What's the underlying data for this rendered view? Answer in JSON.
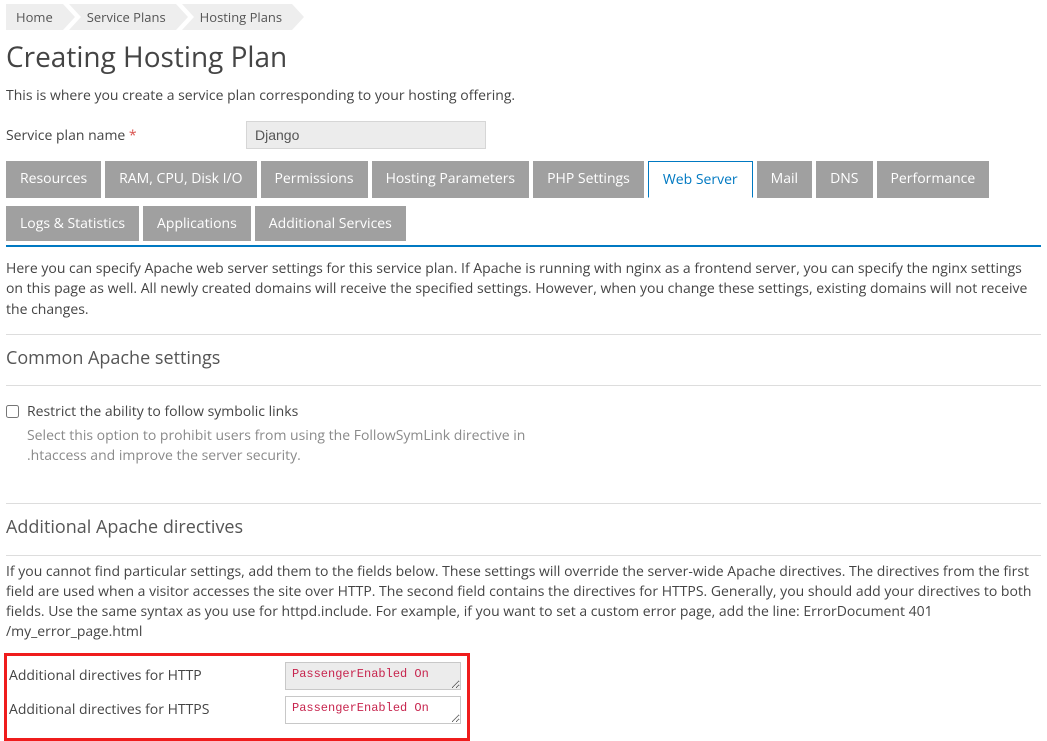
{
  "breadcrumb": [
    "Home",
    "Service Plans",
    "Hosting Plans"
  ],
  "title": "Creating Hosting Plan",
  "description": "This is where you create a service plan corresponding to your hosting offering.",
  "plan_name": {
    "label": "Service plan name",
    "required": "*",
    "value": "Django"
  },
  "tabs": [
    {
      "label": "Resources",
      "active": false
    },
    {
      "label": "RAM, CPU, Disk I/O",
      "active": false
    },
    {
      "label": "Permissions",
      "active": false
    },
    {
      "label": "Hosting Parameters",
      "active": false
    },
    {
      "label": "PHP Settings",
      "active": false
    },
    {
      "label": "Web Server",
      "active": true
    },
    {
      "label": "Mail",
      "active": false
    },
    {
      "label": "DNS",
      "active": false
    },
    {
      "label": "Performance",
      "active": false
    },
    {
      "label": "Logs & Statistics",
      "active": false
    },
    {
      "label": "Applications",
      "active": false
    },
    {
      "label": "Additional Services",
      "active": false
    }
  ],
  "webserver": {
    "intro": "Here you can specify Apache web server settings for this service plan. If Apache is running with nginx as a frontend server, you can specify the nginx settings on this page as well. All newly created domains will receive the specified settings. However, when you change these settings, existing domains will not receive the changes.",
    "common": {
      "title": "Common Apache settings",
      "symlinks_label": "Restrict the ability to follow symbolic links",
      "symlinks_help": "Select this option to prohibit users from using the FollowSymLink directive in .htaccess and improve the server security."
    },
    "directives": {
      "title": "Additional Apache directives",
      "desc": "If you cannot find particular settings, add them to the fields below. These settings will override the server-wide Apache directives. The directives from the first field are used when a visitor accesses the site over HTTP. The second field contains the directives for HTTPS. Generally, you should add your directives to both fields. Use the same syntax as you use for httpd.include. For example, if you want to set a custom error page, add the line: ErrorDocument 401 /my_error_page.html",
      "http_label": "Additional directives for HTTP",
      "http_value": "PassengerEnabled On",
      "https_label": "Additional directives for HTTPS",
      "https_value": "PassengerEnabled On"
    }
  }
}
